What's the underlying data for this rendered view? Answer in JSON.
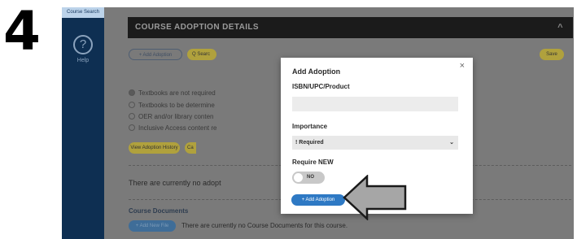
{
  "step_number": "4",
  "sidebar": {
    "tab_label": "Course Search",
    "help_icon_glyph": "?",
    "help_label": "Help"
  },
  "section": {
    "title": "COURSE ADOPTION DETAILS",
    "chevron_glyph": "^"
  },
  "toolbar": {
    "add_adoption_label": "+ Add Adoption",
    "search_label": "Q Searc",
    "save_label": "Save"
  },
  "radio_options": [
    {
      "label": "Textbooks are not required",
      "selected": true
    },
    {
      "label": "Textbooks to be determine",
      "selected": false
    },
    {
      "label": "OER and/or library conten",
      "selected": false
    },
    {
      "label": "Inclusive Access content re",
      "selected": false
    }
  ],
  "buttons": {
    "view_history_label": "View Adoption History",
    "ca_label": "Ca"
  },
  "no_adoptions_text": "There are currently no adopt",
  "course_documents": {
    "title": "Course Documents",
    "add_file_label": "+ Add New File",
    "empty_text": "There are currently no Course Documents for this course."
  },
  "modal": {
    "title": "Add Adoption",
    "close_glyph": "×",
    "isbn_label": "ISBN/UPC/Product",
    "isbn_value": "",
    "importance_label": "Importance",
    "importance_value": "! Required",
    "select_chevron_glyph": "⌄",
    "require_new_label": "Require NEW",
    "require_new_toggle_text": "NO",
    "require_new_on": false,
    "add_button_label": "+ Add Adoption"
  },
  "colors": {
    "sidebar": "#0e2f52",
    "header": "#1b1b1b",
    "accent_yellow": "#b0a13d",
    "modal_button": "#2e79c4",
    "pointer_arrow": "#a6a6a6"
  }
}
